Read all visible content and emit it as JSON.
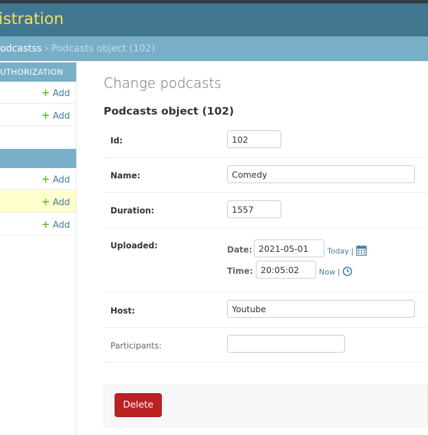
{
  "header": {
    "branding": "istration"
  },
  "breadcrumbs": {
    "parent": "odcastss",
    "separator": "›",
    "current": "Podcasts object (102)"
  },
  "sidebar": {
    "modules": [
      {
        "caption": "UTHORIZATION",
        "rows": [
          {
            "add_label": "Add",
            "highlighted": false
          },
          {
            "add_label": "Add",
            "highlighted": false
          }
        ]
      },
      {
        "caption": "",
        "rows": [
          {
            "add_label": "Add",
            "highlighted": false
          },
          {
            "add_label": "Add",
            "highlighted": true
          },
          {
            "add_label": "Add",
            "highlighted": false
          }
        ]
      }
    ]
  },
  "main": {
    "page_title": "Change podcasts",
    "object_title": "Podcasts object (102)",
    "fields": {
      "id": {
        "label": "Id:",
        "value": "102"
      },
      "name": {
        "label": "Name:",
        "value": "Comedy"
      },
      "duration": {
        "label": "Duration:",
        "value": "1557"
      },
      "uploaded": {
        "label": "Uploaded:",
        "date_label": "Date:",
        "date_value": "2021-05-01",
        "today_link": "Today",
        "time_label": "Time:",
        "time_value": "20:05:02",
        "now_link": "Now",
        "separator": "|"
      },
      "host": {
        "label": "Host:",
        "value": "Youtube"
      },
      "participants": {
        "label": "Participants:",
        "value": ""
      }
    },
    "delete_label": "Delete"
  },
  "colors": {
    "header_bg": "#417690",
    "branding": "#f5dd5d",
    "breadcrumbs_bg": "#79aec8",
    "add_plus": "#70bf2b",
    "link": "#447e9b",
    "delete_bg": "#ba2121"
  }
}
